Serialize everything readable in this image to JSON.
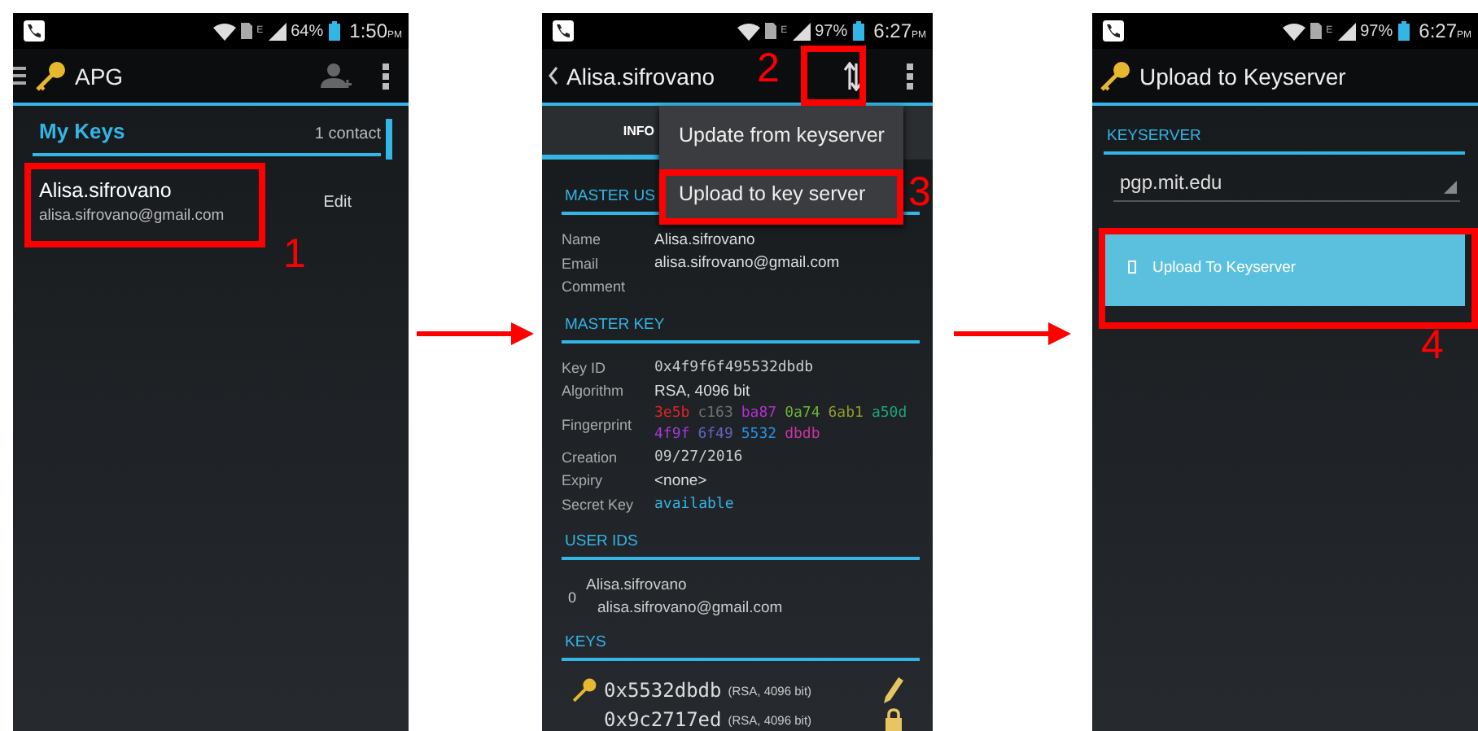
{
  "screens": [
    {
      "kind": "key_list",
      "status_bar": {
        "network": "E",
        "battery": "64%",
        "time": "1:50",
        "ampm": "PM"
      },
      "title": "APG",
      "list_header": {
        "title": "My Keys",
        "count": "1 contact"
      },
      "keys": [
        {
          "name": "Alisa.sifrovano",
          "email": "alisa.sifrovano@gmail.com",
          "action": "Edit"
        }
      ],
      "annotations": [
        {
          "label": "1"
        }
      ]
    },
    {
      "kind": "key_detail",
      "status_bar": {
        "network": "E",
        "battery": "97%",
        "time": "6:27",
        "ampm": "PM"
      },
      "title": "Alisa.sifrovano",
      "tabs": [
        {
          "label": "INFO",
          "selected": true
        }
      ],
      "menu": [
        {
          "label": "Update from keyserver"
        },
        {
          "label": "Upload to key server"
        }
      ],
      "sections": [
        {
          "kind": "fields",
          "title": "MASTER US",
          "rows": [
            {
              "kind": "plain",
              "label": "Name",
              "value": "Alisa.sifrovano"
            },
            {
              "kind": "plain",
              "label": "Email",
              "value": "alisa.sifrovano@gmail.com"
            },
            {
              "kind": "plain",
              "label": "Comment"
            }
          ]
        },
        {
          "kind": "fields",
          "title": "MASTER KEY",
          "rows": [
            {
              "kind": "mono",
              "label": "Key ID",
              "value": "0x4f9f6f495532dbdb"
            },
            {
              "kind": "plain",
              "label": "Algorithm",
              "value": "RSA, 4096 bit"
            },
            {
              "kind": "fingerprint",
              "label": "Fingerprint",
              "chunks": [
                {
                  "text": "3e5b",
                  "color": "#e02424"
                },
                {
                  "text": "c163",
                  "color": "#707070"
                },
                {
                  "text": "ba87",
                  "color": "#b52fd0"
                },
                {
                  "text": "0a74",
                  "color": "#6cb33a"
                },
                {
                  "text": "6ab1",
                  "color": "#8f9d25"
                },
                {
                  "text": "a50d",
                  "color": "#1fa37a"
                },
                {
                  "text": "4f9f",
                  "color": "#a63ad8"
                },
                {
                  "text": "6f49",
                  "color": "#5d67c0"
                },
                {
                  "text": "5532",
                  "color": "#2a8fe0"
                },
                {
                  "text": "dbdb",
                  "color": "#c8359f"
                }
              ]
            },
            {
              "kind": "mono",
              "label": "Creation",
              "value": "09/27/2016"
            },
            {
              "kind": "plain",
              "label": "Expiry",
              "value": "<none>"
            },
            {
              "kind": "accent",
              "label": "Secret Key",
              "value": "available"
            }
          ]
        },
        {
          "kind": "user_ids",
          "title": "USER IDS",
          "items": [
            {
              "index": "0",
              "name": "Alisa.sifrovano",
              "email": "alisa.sifrovano@gmail.com"
            }
          ]
        },
        {
          "kind": "keys",
          "title": "KEYS",
          "items": [
            {
              "kind": "pencil",
              "id": "0x5532dbdb",
              "info": "(RSA, 4096 bit)"
            },
            {
              "kind": "lock",
              "id": "0x9c2717ed",
              "info": "(RSA, 4096 bit)"
            }
          ]
        }
      ],
      "annotations": [
        {
          "label": "2"
        },
        {
          "label": "3"
        }
      ]
    },
    {
      "kind": "upload",
      "status_bar": {
        "network": "E",
        "battery": "97%",
        "time": "6:27",
        "ampm": "PM"
      },
      "title": "Upload to Keyserver",
      "section_title": "KEYSERVER",
      "server": "pgp.mit.edu",
      "button": "Upload To Keyserver",
      "annotations": [
        {
          "label": "4"
        }
      ]
    }
  ]
}
